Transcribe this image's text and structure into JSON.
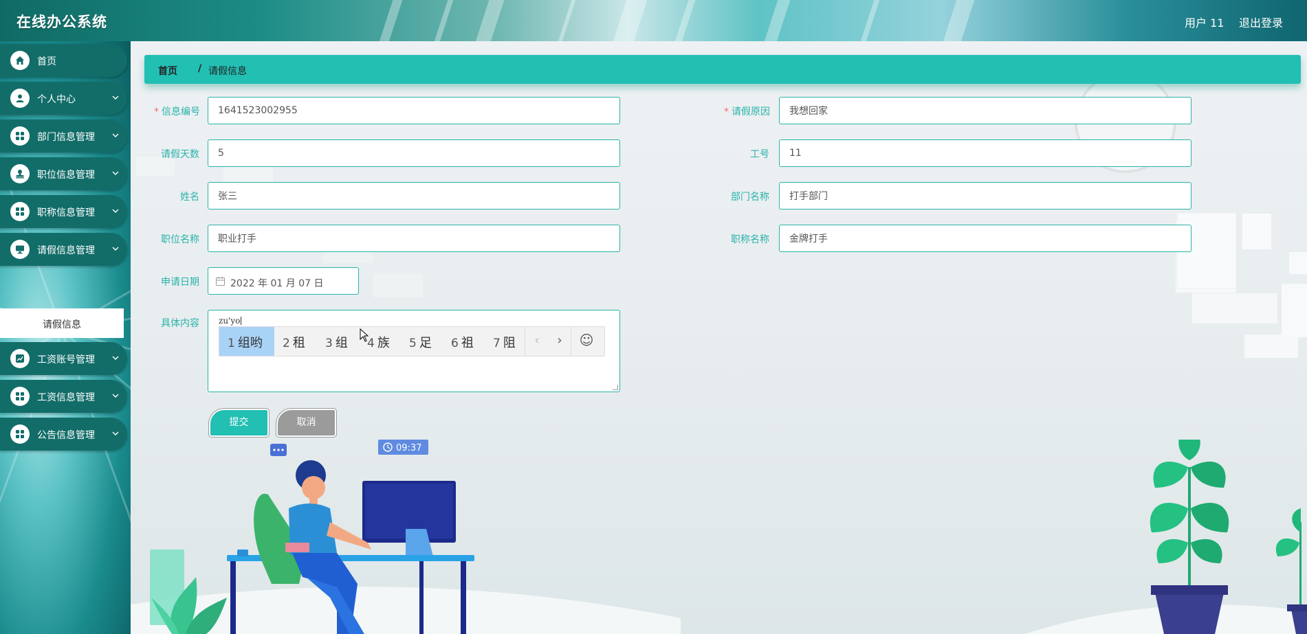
{
  "header": {
    "title": "在线办公系统",
    "user": "用户 11",
    "logout": "退出登录"
  },
  "sidebar": {
    "items": [
      {
        "label": "首页",
        "icon": "home-icon"
      },
      {
        "label": "个人中心",
        "icon": "user-icon"
      },
      {
        "label": "部门信息管理",
        "icon": "grid-icon"
      },
      {
        "label": "职位信息管理",
        "icon": "stamp-icon"
      },
      {
        "label": "职称信息管理",
        "icon": "grid-icon"
      },
      {
        "label": "请假信息管理",
        "icon": "monitor-icon"
      },
      {
        "label": "工资账号管理",
        "icon": "chart-icon"
      },
      {
        "label": "工资信息管理",
        "icon": "grid-icon"
      },
      {
        "label": "公告信息管理",
        "icon": "grid-icon"
      }
    ],
    "active_sub": "请假信息"
  },
  "breadcrumb": {
    "home": "首页",
    "sep": "/",
    "current": "请假信息"
  },
  "form": {
    "info_no": {
      "label": "信息编号",
      "value": "1641523002955"
    },
    "reason": {
      "label": "请假原因",
      "value": "我想回家"
    },
    "days": {
      "label": "请假天数",
      "value": "5"
    },
    "emp_no": {
      "label": "工号",
      "value": "11"
    },
    "name": {
      "label": "姓名",
      "value": "张三"
    },
    "dept": {
      "label": "部门名称",
      "value": "打手部门"
    },
    "position": {
      "label": "职位名称",
      "value": "职业打手"
    },
    "title": {
      "label": "职称名称",
      "value": "金牌打手"
    },
    "date": {
      "label": "申请日期",
      "value": "2022 年 01 月 07 日"
    },
    "content": {
      "label": "具体内容",
      "typed": "zu'yo"
    },
    "submit": "提交",
    "cancel": "取消"
  },
  "ime": {
    "candidates": [
      {
        "n": "1",
        "text": "组哟"
      },
      {
        "n": "2",
        "text": "租"
      },
      {
        "n": "3",
        "text": "组"
      },
      {
        "n": "4",
        "text": "族"
      },
      {
        "n": "5",
        "text": "足"
      },
      {
        "n": "6",
        "text": "祖"
      },
      {
        "n": "7",
        "text": "阻"
      }
    ],
    "prev": "‹",
    "next": "›",
    "emoji": "☺"
  },
  "illustration": {
    "clock": "09:37"
  },
  "colors": {
    "accent": "#22bfb3",
    "sidebar_item": "#126d69",
    "required": "#f56c6c",
    "cancel": "#9b9b9b"
  }
}
